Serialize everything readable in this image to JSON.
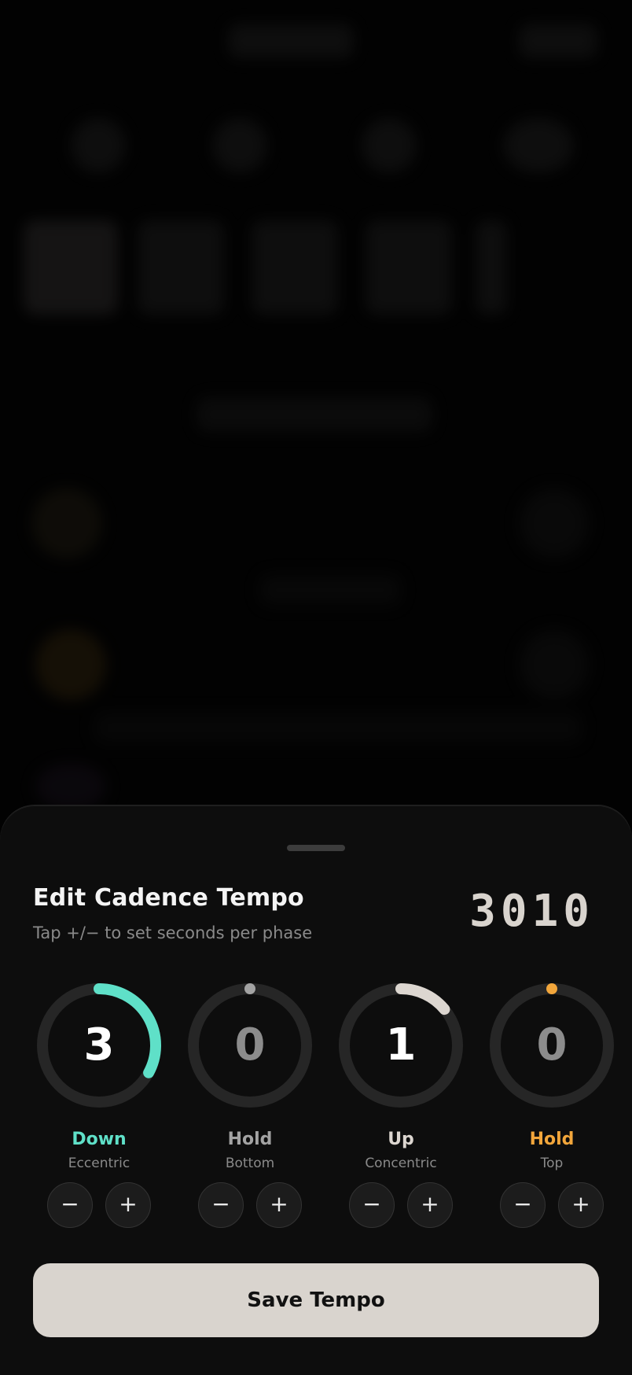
{
  "sheet": {
    "title": "Edit Cadence Tempo",
    "subtitle": "Tap +/− to set seconds per phase",
    "tempo_code": "3010",
    "save_label": "Save Tempo"
  },
  "phases": [
    {
      "value": "3",
      "name": "Down",
      "sub": "Eccentric",
      "color": "#5fe0c8",
      "progress": 0.33
    },
    {
      "value": "0",
      "name": "Hold",
      "sub": "Bottom",
      "color": "#a3a3a3",
      "progress": 0
    },
    {
      "value": "1",
      "name": "Up",
      "sub": "Concentric",
      "color": "#dcd6d0",
      "progress": 0.14
    },
    {
      "value": "0",
      "name": "Hold",
      "sub": "Top",
      "color": "#f2a63b",
      "progress": 0
    }
  ],
  "buttons": {
    "minus": "−",
    "plus": "+"
  },
  "colors": {
    "sheet_bg": "#0d0d0d",
    "ring_track": "#262626",
    "save_bg": "#d9d4ce"
  }
}
